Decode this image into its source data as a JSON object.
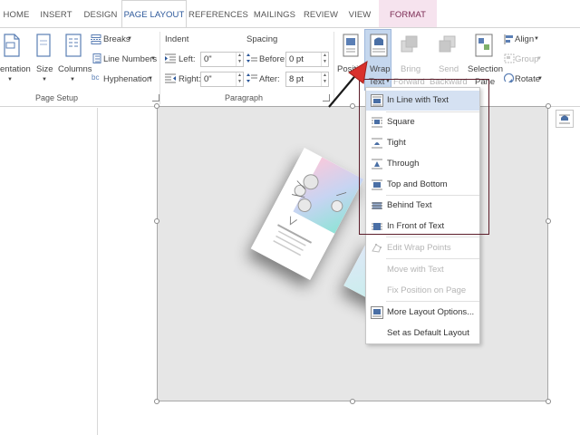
{
  "tabs": [
    "HOME",
    "INSERT",
    "DESIGN",
    "PAGE LAYOUT",
    "REFERENCES",
    "MAILINGS",
    "REVIEW",
    "VIEW",
    "FORMAT"
  ],
  "page_setup": {
    "orientation": "entation",
    "size": "Size",
    "columns": "Columns",
    "breaks": "Breaks",
    "line_numbers": "Line Numbers",
    "hyphenation": "Hyphenation",
    "group_label": "Page Setup"
  },
  "paragraph": {
    "indent_label": "Indent",
    "spacing_label": "Spacing",
    "left_label": "Left:",
    "right_label": "Right:",
    "before_label": "Before:",
    "after_label": "After:",
    "left_value": "0\"",
    "right_value": "0\"",
    "before_value": "0 pt",
    "after_value": "8 pt",
    "group_label": "Paragraph"
  },
  "arrange": {
    "position": "Positi",
    "wrap": "Wrap",
    "wrap_sub": "Text",
    "bring": "Bring",
    "bring_sub": "Forward",
    "send": "Send",
    "send_sub": "Backward",
    "selection": "Selection",
    "selection_sub": "Pane",
    "align": "Align",
    "group": "Group",
    "rotate": "Rotate"
  },
  "wrap_menu": {
    "items": [
      {
        "label": "In Line with Text",
        "icon": "inline-wrap-icon",
        "enabled": true
      },
      {
        "label": "Square",
        "icon": "square-wrap-icon",
        "enabled": true
      },
      {
        "label": "Tight",
        "icon": "tight-wrap-icon",
        "enabled": true
      },
      {
        "label": "Through",
        "icon": "through-wrap-icon",
        "enabled": true
      },
      {
        "label": "Top and Bottom",
        "icon": "top-bottom-wrap-icon",
        "enabled": true
      },
      {
        "label": "Behind Text",
        "icon": "behind-text-icon",
        "enabled": true
      },
      {
        "label": "In Front of Text",
        "icon": "in-front-text-icon",
        "enabled": true
      },
      {
        "label": "Edit Wrap Points",
        "icon": "edit-wrap-points-icon",
        "enabled": false
      },
      {
        "label": "Move with Text",
        "icon": "",
        "enabled": false
      },
      {
        "label": "Fix Position on Page",
        "icon": "",
        "enabled": false
      },
      {
        "label": "More Layout Options...",
        "icon": "layout-options-icon",
        "enabled": true
      },
      {
        "label": "Set as Default Layout",
        "icon": "",
        "enabled": true
      }
    ]
  },
  "colors": {
    "accent": "#2b579a",
    "format_tab_bg": "#f6e3ee",
    "highlight": "#d5e1f2",
    "annotation_box": "#5c1d2a",
    "arrow": "#d9302c"
  }
}
